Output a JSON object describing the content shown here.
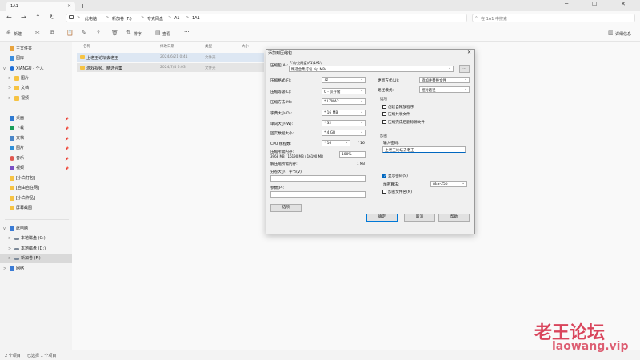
{
  "window": {
    "tab_title": "1A1",
    "tab_close": "×",
    "new_tab": "+",
    "controls": {
      "minimize": "─",
      "maximize": "☐",
      "close": "✕"
    }
  },
  "nav": {
    "back": "←",
    "forward": "→",
    "up": "↑",
    "refresh": "↻",
    "breadcrumbs": [
      "此电脑",
      "新加卷 (F:)",
      "夸克网盘",
      "A1",
      "1A1"
    ],
    "sep": ">",
    "search_placeholder": "在 1A1 中搜索"
  },
  "toolbar": {
    "new_label": "新建",
    "sort_label": "排序",
    "view_label": "查看",
    "more_label": "···",
    "details_label": "详细信息"
  },
  "sidebar": {
    "items": [
      {
        "label": "主文件夹"
      },
      {
        "label": "图库"
      },
      {
        "label": "XIANGU - 个人"
      },
      {
        "label": "图片"
      },
      {
        "label": "文档"
      },
      {
        "label": "视频"
      },
      {
        "label": "桌面"
      },
      {
        "label": "下载"
      },
      {
        "label": "文档"
      },
      {
        "label": "图片"
      },
      {
        "label": "音乐"
      },
      {
        "label": "视频"
      },
      {
        "label": "[小白打包]"
      },
      {
        "label": "[自由自在网]"
      },
      {
        "label": "[小白作品]"
      },
      {
        "label": "屏幕截图"
      },
      {
        "label": "此电脑"
      },
      {
        "label": "本地磁盘 (C:)"
      },
      {
        "label": "本地磁盘 (D:)"
      },
      {
        "label": "新加卷 (F:)"
      },
      {
        "label": "网络"
      }
    ],
    "pin": "📌",
    "chev": ">",
    "chev_open": "v"
  },
  "filelist": {
    "columns": {
      "name": "名称",
      "date": "修改日期",
      "type": "类型",
      "size": "大小"
    },
    "rows": [
      {
        "name": "上老王论坛去老王",
        "date": "2024/6/21 0:41",
        "type": "文件夹"
      },
      {
        "name": "游戏视频、精选合集",
        "date": "2024/7/4 6:03",
        "type": "文件夹"
      }
    ]
  },
  "status": {
    "count": "2 个项目",
    "selected": "已选择 1 个项目"
  },
  "dialog": {
    "title": "添加到压缩包",
    "close": "✕",
    "archive_name_label": "压缩包(A):",
    "archive_path": "F:\\夸克网盘\\A1\\1A1\\",
    "archive_name": "精选合集打包.zip.MP4",
    "browse": "...",
    "format_label": "压缩格式(F):",
    "format_value": "7z",
    "level_label": "压缩等级(L):",
    "level_value": "0 - 仅存储",
    "method_label": "压缩方法(M):",
    "method_value": "* LZMA2",
    "dict_label": "字典大小(D):",
    "dict_value": "* 16 MB",
    "word_label": "单词大小(W):",
    "word_value": "* 32",
    "solid_label": "固实数据大小:",
    "solid_value": "* 4 GB",
    "cpu_label": "CPU 线程数:",
    "cpu_value": "* 16",
    "cpu_total": "/ 16",
    "mem_compress_label": "压缩所需内存:",
    "mem_compress_detail": "3968 MB / 16190 MB / 16190 MB",
    "mem_compress_pct": "100%",
    "mem_decompress_label": "解压缩所需内存:",
    "mem_decompress_value": "1 MB",
    "split_label": "分卷大小，字节(V):",
    "params_label": "参数(P):",
    "options_btn": "选项",
    "update_label": "更新方式(U):",
    "update_value": "添加并替换文件",
    "path_label": "路径模式:",
    "path_value": "相对路径",
    "options_group": "选项",
    "opt_sfx": "创建自释放程序",
    "opt_shared": "压缩共享文件",
    "opt_delete": "压缩完成后删除源文件",
    "encrypt_group": "加密",
    "pw_label": "输入密码:",
    "pw_value": "上老王论坛去老王",
    "show_pw": "显示密码(S)",
    "enc_method_label": "加密算法:",
    "enc_method_value": "AES-256",
    "enc_names": "加密文件名(N)",
    "ok": "确定",
    "cancel": "取消",
    "help": "帮助",
    "dd": "⌄"
  },
  "watermark": {
    "line1": "老王论坛",
    "line2": "laowang.vip"
  },
  "colors": {
    "accent": "#0067c0",
    "folder": "#f6c343",
    "watermark": "#d9455c"
  }
}
